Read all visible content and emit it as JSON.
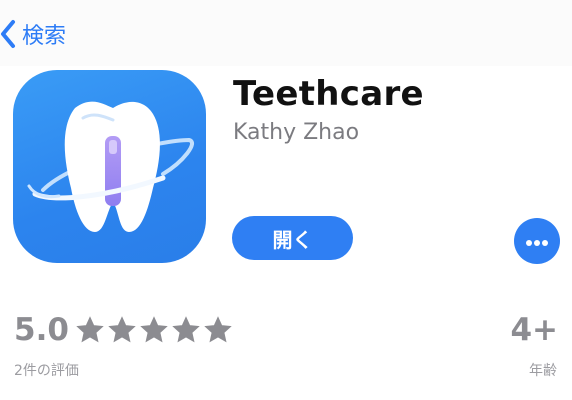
{
  "nav": {
    "back_label": "検索"
  },
  "app": {
    "name": "Teethcare",
    "developer": "Kathy Zhao",
    "open_label": "開く",
    "icon": "tooth-toothbrush-icon"
  },
  "ratings": {
    "score": "5.0",
    "stars_filled": 5,
    "stars_total": 5,
    "count_label": "2件の評価"
  },
  "age": {
    "value": "4+",
    "label": "年齢"
  },
  "colors": {
    "accent": "#2f7ff3",
    "icon_background": "#2c84ee",
    "secondary_text": "#8c8c91"
  }
}
